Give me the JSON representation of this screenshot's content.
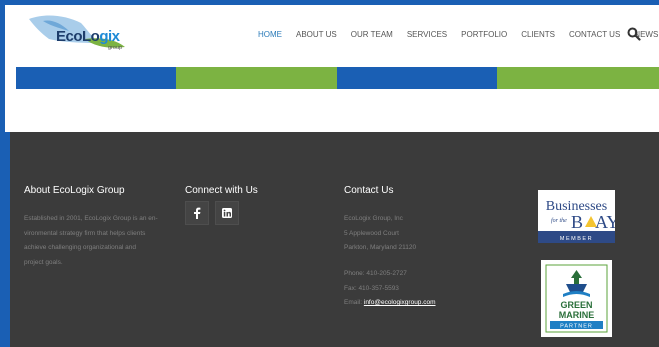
{
  "logo": {
    "text_eco": "EcoLo",
    "text_gix": "gix",
    "sub": "group"
  },
  "nav": {
    "items": [
      {
        "label": "HOME",
        "active": true
      },
      {
        "label": "ABOUT US"
      },
      {
        "label": "OUR TEAM"
      },
      {
        "label": "SERVICES"
      },
      {
        "label": "PORTFOLIO"
      },
      {
        "label": "CLIENTS"
      },
      {
        "label": "CONTACT US"
      },
      {
        "label": "NEWS"
      }
    ],
    "search_icon": "search-icon"
  },
  "bands": {
    "colors": [
      "#1a5fb4",
      "#7cb342",
      "#1a5fb4",
      "#7cb342"
    ]
  },
  "footer": {
    "about": {
      "title": "About EcoLogix Group",
      "lines": [
        "Established in 2001, EcoLogix Group is an en-",
        "vironmental strategy firm that helps clients",
        "achieve challenging organizational and",
        "project goals."
      ]
    },
    "connect": {
      "title": "Connect with Us",
      "icons": [
        "facebook-icon",
        "linkedin-icon"
      ]
    },
    "contact": {
      "title": "Contact Us",
      "lines": [
        "EcoLogix Group, Inc",
        "5 Applewood Court",
        "Parkton, Maryland 21120"
      ],
      "phone": "Phone: 410-205-2727",
      "fax": "Fax: 410-357-5593",
      "email_label": "Email:",
      "email": "info@ecologixgroup.com"
    },
    "badges": {
      "bay": {
        "line1": "Businesses",
        "for": "for the",
        "bay": "B",
        "ay": "AY",
        "member": "MEMBER"
      },
      "green": {
        "line1": "GREEN",
        "line2": "MARINE",
        "line3": "PARTNER"
      }
    }
  },
  "colors": {
    "brand_blue": "#1a5fb4",
    "brand_green": "#7cb342",
    "footer_bg": "#3b3b3b",
    "nav_active": "#2a7ab8"
  }
}
